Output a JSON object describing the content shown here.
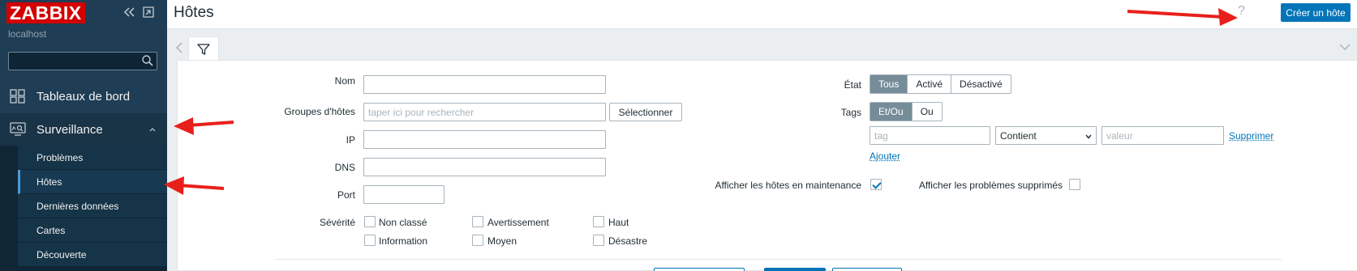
{
  "sidebar": {
    "logo": "ZABBIX",
    "server": "localhost",
    "search_placeholder": "",
    "menu": {
      "dashboards": "Tableaux de bord",
      "monitoring": "Surveillance"
    },
    "submenu": [
      "Problèmes",
      "Hôtes",
      "Dernières données",
      "Cartes",
      "Découverte"
    ]
  },
  "header": {
    "title": "Hôtes",
    "help": "?",
    "create_button": "Créer un hôte"
  },
  "filter": {
    "name_label": "Nom",
    "host_groups_label": "Groupes d'hôtes",
    "host_groups_placeholder": "taper ici pour rechercher",
    "select_button": "Sélectionner",
    "ip_label": "IP",
    "dns_label": "DNS",
    "port_label": "Port",
    "severity_label": "Sévérité",
    "severities": {
      "not_classified": "Non classé",
      "information": "Information",
      "warning": "Avertissement",
      "average": "Moyen",
      "high": "Haut",
      "disaster": "Désastre"
    },
    "state_label": "État",
    "state_options": [
      "Tous",
      "Activé",
      "Désactivé"
    ],
    "state_selected": "Tous",
    "tags_label": "Tags",
    "tags_options": [
      "Et/Ou",
      "Ou"
    ],
    "tags_selected": "Et/Ou",
    "tag_placeholder": "tag",
    "tag_operator": "Contient",
    "value_placeholder": "valeur",
    "remove_link": "Supprimer",
    "add_link": "Ajouter",
    "show_maintenance_label": "Afficher les hôtes en maintenance",
    "show_maintenance_checked": true,
    "show_suppressed_label": "Afficher les problèmes supprimés",
    "show_suppressed_checked": false
  },
  "colors": {
    "sidebar_bg": "#1f3d54",
    "logo_bg": "#d40000",
    "accent": "#0275b8",
    "annotation_arrow": "#e8201c"
  }
}
